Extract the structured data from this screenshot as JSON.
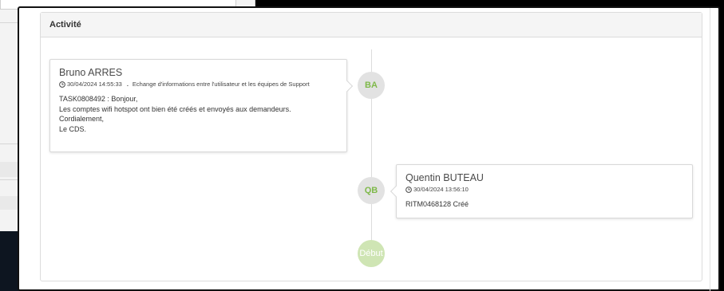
{
  "panel": {
    "title": "Activité"
  },
  "timeline": {
    "entries": [
      {
        "initials": "BA",
        "author": "Bruno ARRES",
        "timestamp": "30/04/2024 14:55:33",
        "category": "Echange d'informations entre l'utilisateur et les équipes de Support",
        "lines": [
          "TASK0808492 : Bonjour,",
          "Les comptes wifi hotspot ont bien été créés et envoyés aux demandeurs.",
          "Cordialement,",
          "Le CDS."
        ]
      },
      {
        "initials": "QB",
        "author": "Quentin BUTEAU",
        "timestamp": "30/04/2024 13:56:10",
        "lines": [
          "RITM0468128 Créé"
        ]
      }
    ],
    "start_label": "Début"
  },
  "colors": {
    "initials_text": "#7fb94a",
    "avatar_bg": "#e2e2e2",
    "start_node_bg": "#cfe5b4",
    "header_bg": "#f5f5f5"
  },
  "icons": {
    "timestamp": "clock-icon"
  }
}
